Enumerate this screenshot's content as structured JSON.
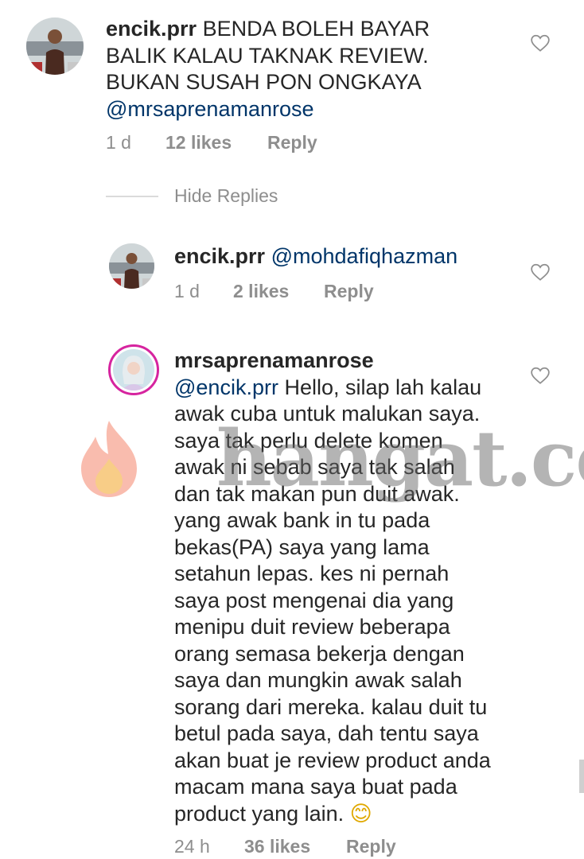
{
  "comments": [
    {
      "username": "encik.prr",
      "body": " BENDA BOLEH BAYAR\nBALIK KALAU TAKNAK REVIEW.\nBUKAN SUSAH PON ONGKAYA\n",
      "mention": "@mrsaprenamanrose",
      "time": "1 d",
      "likes": "12 likes",
      "reply": "Reply",
      "avatar_icon": "profile-photo-man"
    }
  ],
  "replies_toggle": {
    "label": "Hide Replies"
  },
  "replies": [
    {
      "username": "encik.prr",
      "mention": "@mohdafiqhazman",
      "time": "1 d",
      "likes": "2 likes",
      "reply": "Reply",
      "avatar_icon": "profile-photo-man"
    },
    {
      "username": "mrsaprenamanrose",
      "mention": "@encik.prr",
      "body": " Hello, silap lah kalau\nawak cuba untuk malukan saya.\nsaya tak perlu delete komen\nawak ni sebab saya tak salah\ndan tak makan pun duit awak.\nyang awak bank in tu pada\nbekas(PA) saya yang lama\nsetahun lepas. kes ni pernah\nsaya post mengenai dia yang\nmenipu duit review beberapa\norang semasa bekerja dengan\nsaya dan mungkin awak salah\nsorang dari mereka. kalau duit tu\nbetul pada saya, dah tentu saya\nakan buat je review product anda\nmacam mana saya buat pada\nproduct yang lain. ",
      "emoji": "😊",
      "time": "24 h",
      "likes": "36 likes",
      "reply": "Reply",
      "avatar_icon": "profile-photo-woman-story-ring"
    }
  ],
  "watermark": {
    "text": "hangat.com",
    "icon": "flame-icon"
  },
  "colors": {
    "text": "#262626",
    "meta": "#8e8e8e",
    "mention": "#003569",
    "story_ring": "#d6249f"
  }
}
